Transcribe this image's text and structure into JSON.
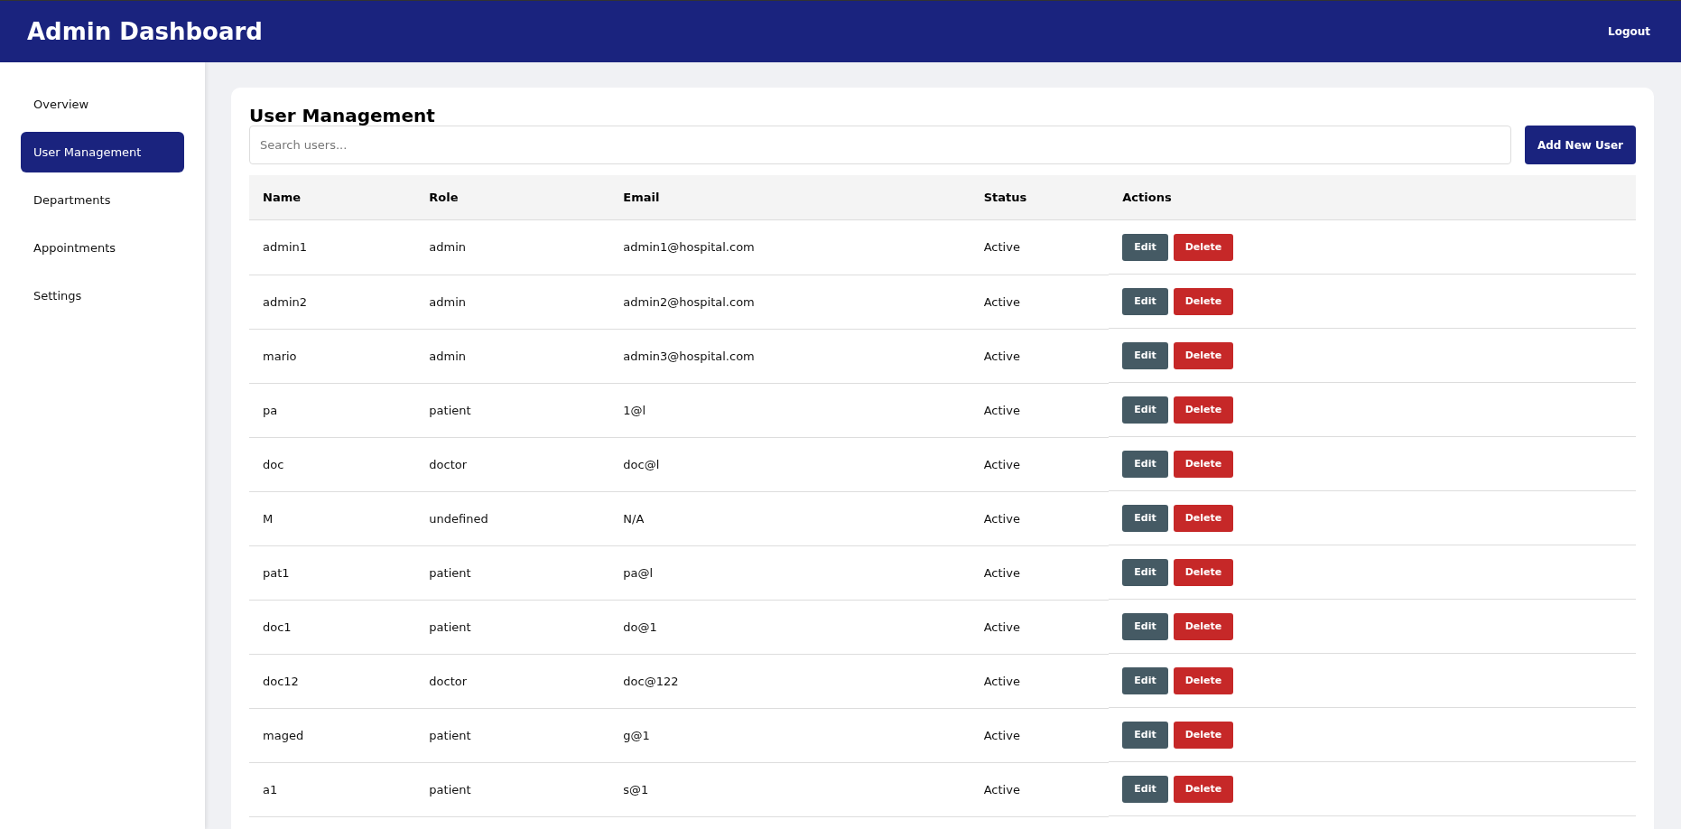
{
  "header": {
    "title": "Admin Dashboard",
    "logout": "Logout"
  },
  "sidebar": {
    "items": [
      {
        "label": "Overview",
        "selected": false
      },
      {
        "label": "User Management",
        "selected": true
      },
      {
        "label": "Departments",
        "selected": false
      },
      {
        "label": "Appointments",
        "selected": false
      },
      {
        "label": "Settings",
        "selected": false
      }
    ]
  },
  "panel": {
    "title": "User Management",
    "search": {
      "placeholder": "Search users..."
    },
    "add_button": "Add New User"
  },
  "table": {
    "columns": [
      "Name",
      "Role",
      "Email",
      "Status",
      "Actions"
    ],
    "rows": [
      {
        "name": "admin1",
        "role": "admin",
        "email": "admin1@hospital.com",
        "status": "Active",
        "actions": [
          "Edit",
          "Delete"
        ]
      },
      {
        "name": "admin2",
        "role": "admin",
        "email": "admin2@hospital.com",
        "status": "Active",
        "actions": [
          "Edit",
          "Delete"
        ]
      },
      {
        "name": "mario",
        "role": "admin",
        "email": "admin3@hospital.com",
        "status": "Active",
        "actions": [
          "Edit",
          "Delete"
        ]
      },
      {
        "name": "pa",
        "role": "patient",
        "email": "1@l",
        "status": "Active",
        "actions": [
          "Edit",
          "Delete"
        ]
      },
      {
        "name": "doc",
        "role": "doctor",
        "email": "doc@l",
        "status": "Active",
        "actions": [
          "Edit",
          "Delete"
        ]
      },
      {
        "name": "M",
        "role": "undefined",
        "email": "N/A",
        "status": "Active",
        "actions": [
          "Edit",
          "Delete"
        ]
      },
      {
        "name": "pat1",
        "role": "patient",
        "email": "pa@l",
        "status": "Active",
        "actions": [
          "Edit",
          "Delete"
        ]
      },
      {
        "name": "doc1",
        "role": "patient",
        "email": "do@1",
        "status": "Active",
        "actions": [
          "Edit",
          "Delete"
        ]
      },
      {
        "name": "doc12",
        "role": "doctor",
        "email": "doc@122",
        "status": "Active",
        "actions": [
          "Edit",
          "Delete"
        ]
      },
      {
        "name": "maged",
        "role": "patient",
        "email": "g@1",
        "status": "Active",
        "actions": [
          "Edit",
          "Delete"
        ]
      },
      {
        "name": "a1",
        "role": "patient",
        "email": "s@1",
        "status": "Active",
        "actions": [
          "Edit",
          "Delete"
        ]
      }
    ]
  }
}
